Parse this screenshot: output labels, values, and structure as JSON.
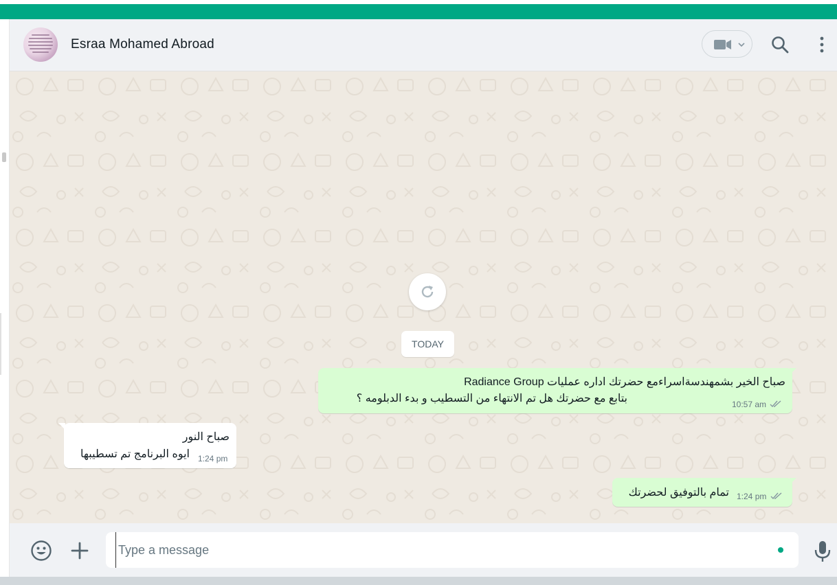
{
  "colors": {
    "accent": "#00a884",
    "header_bg": "#f0f2f5",
    "chat_bg": "#efeae2",
    "outgoing_bubble": "#d9fdd3",
    "incoming_bubble": "#ffffff",
    "read_ticks": "#8696a0"
  },
  "header": {
    "contact_name": "Esraa Mohamed Abroad",
    "icons": [
      "avatar",
      "video-call-icon",
      "chevron-down-icon",
      "search-icon",
      "menu-icon"
    ]
  },
  "chat": {
    "date_divider": "TODAY",
    "reload_icon": "refresh-icon",
    "messages": [
      {
        "direction": "outgoing",
        "lines": [
          "صباح الخير بشمهندسةاسراءمع  حضرتك اداره عمليات Radiance Group",
          "بتابع مع حضرتك هل تم الانتهاء من التسطيب و بدء الدبلومه ؟"
        ],
        "time": "10:57 am",
        "status": "read"
      },
      {
        "direction": "incoming",
        "lines": [
          "صباح النور",
          "ايوه البرنامج تم تسطيبها"
        ],
        "time": "1:24 pm"
      },
      {
        "direction": "outgoing",
        "lines": [
          "تمام بالتوفيق لحضرتك"
        ],
        "time": "1:24 pm",
        "status": "read"
      }
    ]
  },
  "composer": {
    "placeholder": "Type a message",
    "value": "",
    "icons": [
      "emoji-icon",
      "plus-icon",
      "microphone-icon"
    ]
  }
}
